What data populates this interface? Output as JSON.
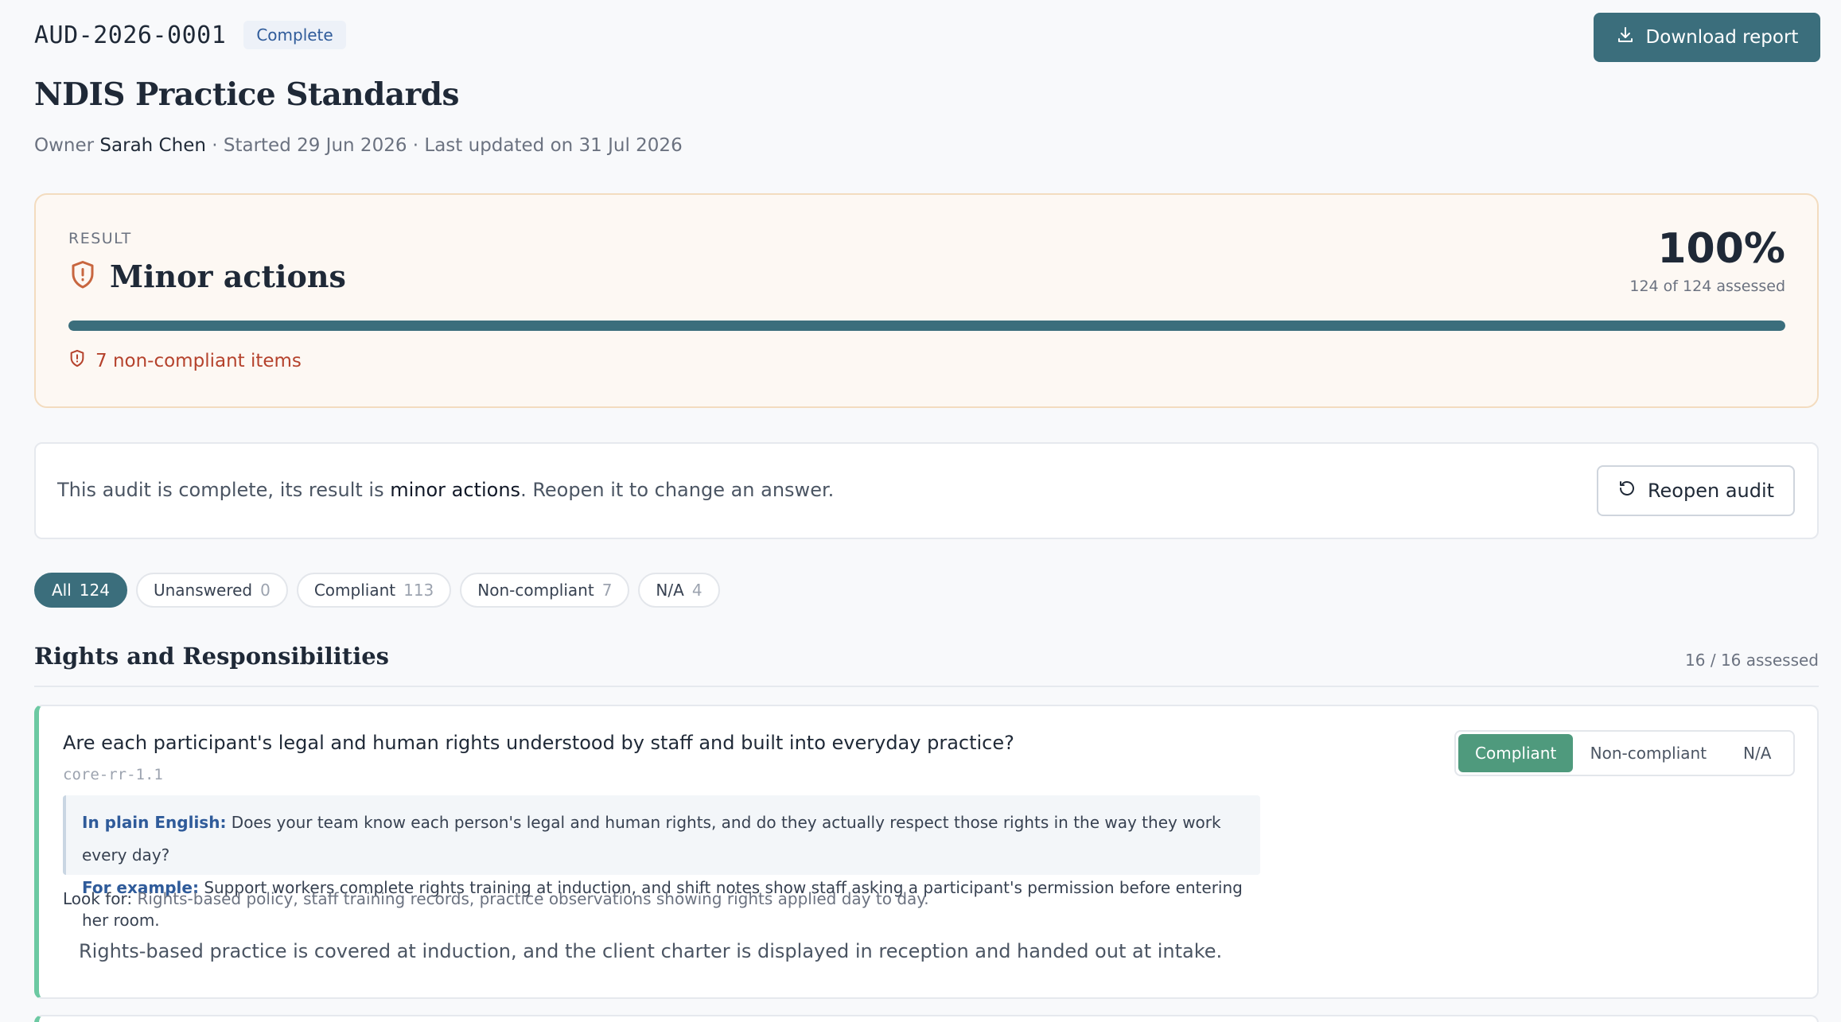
{
  "audit": {
    "id": "AUD-2026-0001",
    "status": "Complete",
    "title": "NDIS Practice Standards",
    "owner_label": "Owner",
    "owner_name": "Sarah Chen",
    "meta_rest": "· Started 29 Jun 2026 · Last updated on 31 Jul 2026"
  },
  "toolbar": {
    "download_label": "Download report"
  },
  "result": {
    "label": "RESULT",
    "title": "Minor actions",
    "percent": "100%",
    "assessed": "124 of 124 assessed",
    "progress_fraction": 1.0,
    "noncompliant_text": "7 non-compliant items"
  },
  "banner": {
    "text_before": "This audit is complete, its result is ",
    "text_strong": "minor actions",
    "text_after": ". Reopen it to change an answer.",
    "reopen_label": "Reopen audit"
  },
  "filters": [
    {
      "label": "All",
      "count": "124",
      "active": true
    },
    {
      "label": "Unanswered",
      "count": "0",
      "active": false
    },
    {
      "label": "Compliant",
      "count": "113",
      "active": false
    },
    {
      "label": "Non-compliant",
      "count": "7",
      "active": false
    },
    {
      "label": "N/A",
      "count": "4",
      "active": false
    }
  ],
  "section": {
    "title": "Rights and Responsibilities",
    "assessed": "16 / 16 assessed"
  },
  "question": {
    "text": "Are each participant's legal and human rights understood by staff and built into everyday practice?",
    "code": "core-rr-1.1",
    "plain_label": "In plain English:",
    "plain_text": "Does your team know each person's legal and human rights, and do they actually respect those rights in the way they work every day?",
    "example_label": "For example:",
    "example_text": "Support workers complete rights training at induction, and shift notes show staff asking a participant's permission before entering her room.",
    "lookfor_label": "Look for:",
    "lookfor_text": "Rights-based policy, staff training records, practice observations showing rights applied day to day.",
    "note": "Rights-based practice is covered at induction, and the client charter is displayed in reception and handed out at intake.",
    "answers": [
      "Compliant",
      "Non-compliant",
      "N/A"
    ],
    "selected": "Compliant"
  },
  "colors": {
    "accent": "#3b6e7c",
    "compliant": "#4f9a7d",
    "warning": "#b5422c"
  }
}
